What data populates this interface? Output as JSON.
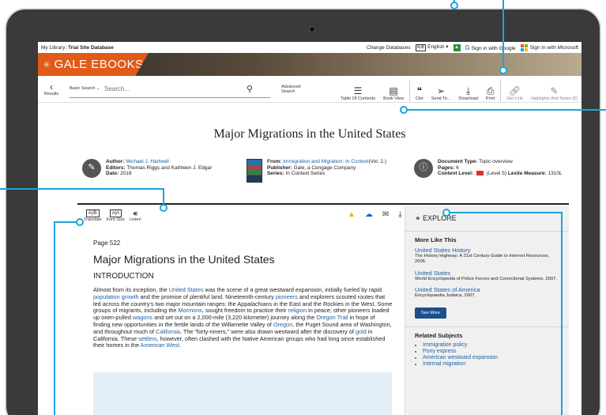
{
  "topbar": {
    "library_prefix": "My Library:",
    "library_name": "Trial Site Database",
    "change_databases": "Change Databases",
    "language": "English",
    "google_signin": "Sign in with Google",
    "microsoft_signin": "Sign in with Microsoft"
  },
  "brand": {
    "name": "GALE EBOOKS"
  },
  "toolbar": {
    "back_label": "Results",
    "basic_search_label": "Basic Search",
    "search_placeholder": "Search...",
    "advanced_search": "Advanced Search",
    "tools": {
      "toc": "Table Of Contents",
      "bookview": "Book View",
      "cite": "Cite",
      "sendto": "Send To...",
      "download": "Download",
      "print": "Print",
      "getlink": "Get Link",
      "highlights": "Highlights And Notes (6)"
    }
  },
  "document": {
    "title": "Major Migrations in the United States",
    "author_label": "Author:",
    "author": "Michael J. Hartwell",
    "editors_label": "Editors:",
    "editors": "Thomas Riggs and Kathleen J. Edgar",
    "date_label": "Date:",
    "date": "2018",
    "from_label": "From:",
    "from": "Immigration and Migration: In Context",
    "volume": "(Vol. 2.)",
    "publisher_label": "Publisher:",
    "publisher": "Gale, a Cengage Company",
    "series_label": "Series:",
    "series": "In Context Series",
    "doctype_label": "Document Type:",
    "doctype": "Topic overview",
    "pages_label": "Pages:",
    "pages": "6",
    "content_level_label": "Content Level:",
    "content_level": "(Level 5)",
    "lexile_label": "Lexile Measure:",
    "lexile": "1310L"
  },
  "article_tools": {
    "translate": "Translate",
    "fontsize": "Font Size",
    "listen": "Listen"
  },
  "article": {
    "page": "Page 522",
    "heading": "Major Migrations in the United States",
    "section": "INTRODUCTION",
    "p1": "Almost from its inception, the ",
    "l_us": "United States",
    "p2": " was the scene of a great westward expansion, initially fueled by rapid ",
    "l_pop": "population growth",
    "p3": " and the promise of plentiful land. Nineteenth-century ",
    "l_pio": "pioneers",
    "p4": " and explorers scouted routes that led across the country's two major mountain ranges: the Appalachians in the East and the Rockies in the West. Some groups of migrants, including the ",
    "l_mor": "Mormons",
    "p5": ", sought freedom to practice their ",
    "l_rel": "religion",
    "p6": " in peace; other pioneers loaded up oxen-pulled ",
    "l_wag": "wagons",
    "p7": " and set out on a 2,000-mile (3,220 kilometer) journey along the ",
    "l_ore": "Oregon Trail",
    "p8": " in hope of finding new opportunities in the fertile lands of the Willamette Valley of ",
    "l_or2": "Oregon",
    "p9": ", the Puget Sound area of Washington, and throughout much of ",
    "l_cal": "California",
    "p10": ". The \"forty-niners,\" were also drawn westward after the discovery of ",
    "l_gold": "gold",
    "p11": " in California. These ",
    "l_set": "settlers",
    "p12": ", however, often clashed with the Native American groups who had long since established their homes in the ",
    "l_aw": "American West",
    "p13": "."
  },
  "explore": {
    "title": "EXPLORE",
    "more_like_this": "More Like This",
    "related": [
      {
        "title": "United States History",
        "source": "The History Highway: A 21st Century Guide to Internet Resources, 2006."
      },
      {
        "title": "United States",
        "source": "World Encyclopedia of Police Forces and Correctional Systems, 2007."
      },
      {
        "title": "United States of America",
        "source": "Encyclopaedia Judaica, 2007."
      }
    ],
    "see_more": "See More",
    "related_subjects": "Related Subjects",
    "subjects": [
      "Immigration policy",
      "Pony express",
      "American westward expansion",
      "Internal migration"
    ]
  },
  "colors": {
    "callout": "#1aa6d9",
    "brand_orange": "#e05a1a",
    "link": "#1a5fa8",
    "see_more_bg": "#1d4f8a"
  }
}
